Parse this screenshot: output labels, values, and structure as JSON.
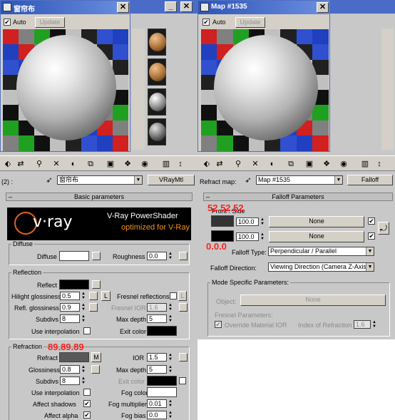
{
  "left_window": {
    "title": "窗帘布",
    "auto_label": "Auto",
    "update_label": "Update",
    "material_level_label": "(2) :",
    "material_name": "窗帘布",
    "material_type": "VRayMtl",
    "basic_rollout": "Basic parameters",
    "vray_logo": "v·ray",
    "vray_title": "V-Ray PowerShader",
    "vray_subtitle": "optimized for V-Ray",
    "diffuse": {
      "group": "Diffuse",
      "diffuse_label": "Diffuse",
      "roughness_label": "Roughness",
      "roughness_value": "0.0"
    },
    "reflection": {
      "group": "Reflection",
      "reflect_label": "Reflect",
      "hilight_label": "Hilight glossiness",
      "hilight_value": "0.5",
      "l_button": "L",
      "fresnel_label": "Fresnel reflections",
      "refl_gloss_label": "Refl. glossiness",
      "refl_gloss_value": "0.9",
      "fresnel_ior_label": "Fresnel IOR",
      "fresnel_ior_value": "1.6",
      "subdivs_label": "Subdivs",
      "subdivs_value": "8",
      "max_depth_label": "Max depth",
      "max_depth_value": "5",
      "use_interp_label": "Use interpolation",
      "exit_color_label": "Exit color"
    },
    "refraction": {
      "group": "Refraction",
      "refract_label": "Refract",
      "m_button": "M",
      "ior_label": "IOR",
      "ior_value": "1.5",
      "glossiness_label": "Glossiness",
      "glossiness_value": "0.8",
      "max_depth_label": "Max depth",
      "max_depth_value": "5",
      "subdivs_label": "Subdivs",
      "subdivs_value": "8",
      "exit_color_label": "Exit color",
      "use_interp_label": "Use interpolation",
      "fog_color_label": "Fog color",
      "affect_shadows_label": "Affect shadows",
      "fog_mult_label": "Fog multiplier",
      "fog_mult_value": "0.01",
      "affect_alpha_label": "Affect alpha",
      "fog_bias_label": "Fog bias",
      "fog_bias_value": "0.0"
    },
    "annotation": "89.89.89"
  },
  "right_window": {
    "title": "Map #1535",
    "auto_label": "Auto",
    "update_label": "Update",
    "refract_map_label": "Refract map:",
    "map_name": "Map #1535",
    "map_type": "Falloff",
    "falloff_rollout": "Falloff Parameters",
    "front_side_label": "Front : Side",
    "front_value": "100.0",
    "side_value": "100.0",
    "none1": "None",
    "none2": "None",
    "falloff_type_label": "Falloff Type:",
    "falloff_type_value": "Perpendicular / Parallel",
    "falloff_dir_label": "Falloff Direction:",
    "falloff_dir_value": "Viewing Direction (Camera Z-Axis)",
    "mode_group": "Mode Specific Parameters:",
    "object_label": "Object:",
    "object_none": "None",
    "fresnel_params_label": "Fresnel Parameters:",
    "override_label": "Override Material IOR",
    "ior_label": "Index of Refraction",
    "ior_value": "1.6",
    "annotation_top": "52.52.52",
    "annotation_bottom": "0.0.0"
  },
  "colors": {
    "diffuse": "#ffffff",
    "reflect": "#000000",
    "refract": "#595959",
    "exit": "#000000",
    "fog": "#ffffff",
    "front": "#343434",
    "side": "#000000",
    "annotation": "#ff2020",
    "title_bar": "#2d55b8"
  }
}
